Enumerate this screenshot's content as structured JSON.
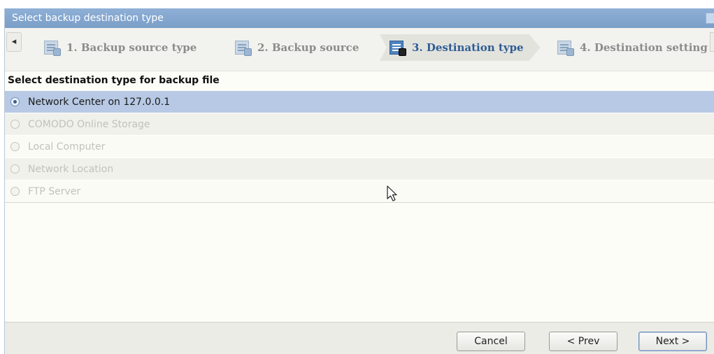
{
  "window": {
    "title": "Select backup destination type"
  },
  "wizard": {
    "steps": [
      {
        "label": "1. Backup source type",
        "icon": "backup-source-type-icon",
        "active": false
      },
      {
        "label": "2. Backup source",
        "icon": "backup-source-icon",
        "active": false
      },
      {
        "label": "3. Destination type",
        "icon": "destination-type-icon",
        "active": true
      },
      {
        "label": "4. Destination setting",
        "icon": "destination-setting-icon",
        "active": false
      }
    ],
    "scroll_left_icon": "◂",
    "accent_color": "#2f5d95"
  },
  "content": {
    "section_title": "Select destination type for backup file",
    "options": [
      {
        "label": "Network Center on 127.0.0.1",
        "selected": true,
        "enabled": true
      },
      {
        "label": "COMODO Online Storage",
        "selected": false,
        "enabled": false
      },
      {
        "label": "Local Computer",
        "selected": false,
        "enabled": false
      },
      {
        "label": "Network Location",
        "selected": false,
        "enabled": false
      },
      {
        "label": "FTP Server",
        "selected": false,
        "enabled": false
      }
    ]
  },
  "footer": {
    "cancel_label": "Cancel",
    "prev_label": "< Prev",
    "next_label": "Next >"
  }
}
